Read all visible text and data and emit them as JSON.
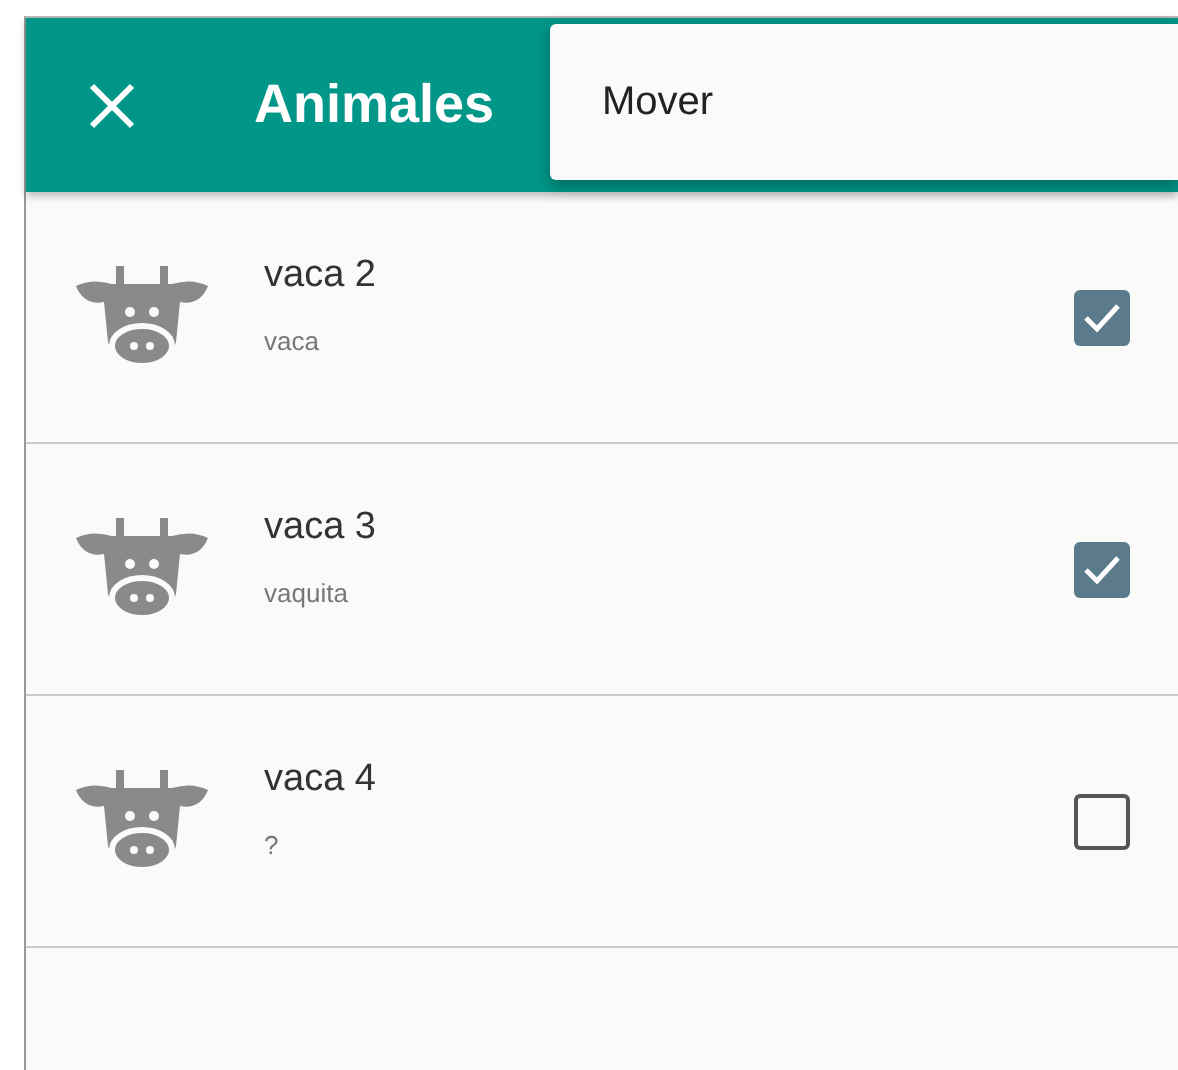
{
  "header": {
    "title": "Animales"
  },
  "menu": {
    "items": [
      {
        "label": "Mover"
      }
    ]
  },
  "animals": [
    {
      "name": "vaca 2",
      "subtitle": "vaca",
      "checked": true
    },
    {
      "name": "vaca 3",
      "subtitle": "vaquita",
      "checked": true
    },
    {
      "name": "vaca 4",
      "subtitle": "?",
      "checked": false
    }
  ]
}
